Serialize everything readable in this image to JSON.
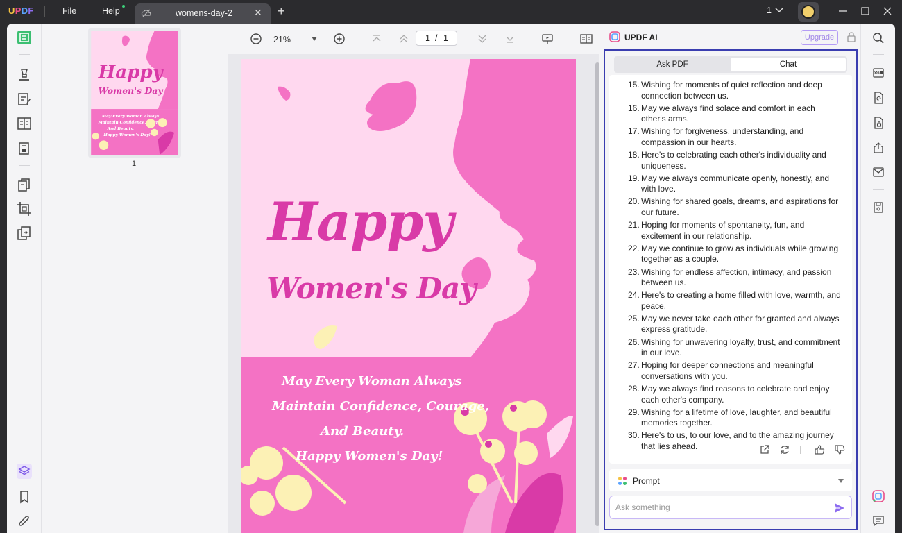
{
  "app": {
    "logo": "UPDF"
  },
  "menu": {
    "file": "File",
    "help": "Help"
  },
  "tab": {
    "title": "womens-day-2"
  },
  "titlebar": {
    "page_count": "1"
  },
  "toolbar": {
    "zoom": "21%",
    "current_page": "1",
    "page_sep": "/",
    "total_pages": "1"
  },
  "thumbnail": {
    "page_label": "1"
  },
  "pdf": {
    "title_line1": "Happy",
    "title_line2": "Women's Day",
    "quote_line1": "May Every Woman Always",
    "quote_line2": "Maintain Confidence, Courage,",
    "quote_line3": "And Beauty.",
    "quote_line4": "Happy Women's Day!"
  },
  "ai": {
    "title": "UPDF AI",
    "upgrade": "Upgrade",
    "tabs": [
      "Ask PDF",
      "Chat"
    ],
    "active_tab": "Chat",
    "messages": [
      {
        "num": "15.",
        "text": "Wishing for moments of quiet reflection and deep connection between us."
      },
      {
        "num": "16.",
        "text": "May we always find solace and comfort in each other's arms."
      },
      {
        "num": "17.",
        "text": "Wishing for forgiveness, understanding, and compassion in our hearts."
      },
      {
        "num": "18.",
        "text": "Here's to celebrating each other's individuality and uniqueness."
      },
      {
        "num": "19.",
        "text": "May we always communicate openly, honestly, and with love."
      },
      {
        "num": "20.",
        "text": "Wishing for shared goals, dreams, and aspirations for our future."
      },
      {
        "num": "21.",
        "text": "Hoping for moments of spontaneity, fun, and excitement in our relationship."
      },
      {
        "num": "22.",
        "text": "May we continue to grow as individuals while growing together as a couple."
      },
      {
        "num": "23.",
        "text": "Wishing for endless affection, intimacy, and passion between us."
      },
      {
        "num": "24.",
        "text": "Here's to creating a home filled with love, warmth, and peace."
      },
      {
        "num": "25.",
        "text": "May we never take each other for granted and always express gratitude."
      },
      {
        "num": "26.",
        "text": "Wishing for unwavering loyalty, trust, and commitment in our love."
      },
      {
        "num": "27.",
        "text": "Hoping for deeper connections and meaningful conversations with you."
      },
      {
        "num": "28.",
        "text": "May we always find reasons to celebrate and enjoy each other's company."
      },
      {
        "num": "29.",
        "text": "Wishing for a lifetime of love, laughter, and beautiful memories together."
      },
      {
        "num": "30.",
        "text": "Here's to us, to our love, and to the amazing journey that lies ahead."
      }
    ],
    "prompt_label": "Prompt",
    "ask_placeholder": "Ask something"
  },
  "colors": {
    "accent": "#3a3db0",
    "brand_pink": "#f472c4",
    "dark_pink": "#d93aa7",
    "light_pink": "#ffd8ef",
    "cream": "#fcf1b5"
  }
}
